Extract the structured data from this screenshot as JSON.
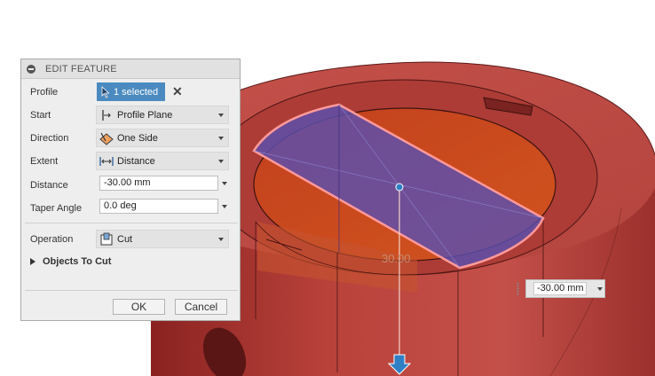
{
  "panel": {
    "title": "EDIT FEATURE",
    "fields": {
      "profile": {
        "label": "Profile",
        "value": "1 selected"
      },
      "start": {
        "label": "Start",
        "value": "Profile Plane"
      },
      "direction": {
        "label": "Direction",
        "value": "One Side"
      },
      "extent": {
        "label": "Extent",
        "value": "Distance"
      },
      "distance": {
        "label": "Distance",
        "value": "-30.00 mm"
      },
      "taper_angle": {
        "label": "Taper Angle",
        "value": "0.0 deg"
      },
      "operation": {
        "label": "Operation",
        "value": "Cut"
      }
    },
    "objects_to_cut": "Objects To Cut",
    "buttons": {
      "ok": "OK",
      "cancel": "Cancel"
    }
  },
  "viewport": {
    "dimension_label": "30.00",
    "distance_input": "-30.00 mm"
  },
  "colors": {
    "body_red": "#b8403a",
    "profile_blue": "#5a4fb0",
    "highlight_pink": "#ff9a9a",
    "manipulator_blue": "#2f7fc4",
    "accent_blue": "#4a8ac0"
  },
  "icons": {
    "profile": "cursor-select-icon",
    "start": "profile-plane-icon",
    "direction": "one-side-icon",
    "extent": "distance-icon",
    "operation": "cut-icon",
    "header": "collapse-icon",
    "manipulator": "drag-arrow-icon"
  }
}
